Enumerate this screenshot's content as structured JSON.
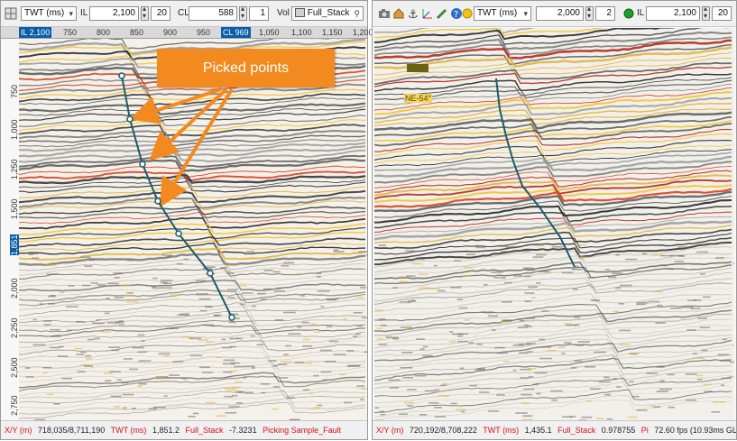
{
  "left": {
    "domain_select": "TWT (ms)",
    "il_label": "IL",
    "il_value": "2,100",
    "il_step": "20",
    "cl_label": "CL",
    "cl_value": "588",
    "cl_step": "1",
    "vol_label": "Vol",
    "vol_value": "Full_Stack",
    "ruler_labels": [
      "IL 2,100",
      "750",
      "800",
      "850",
      "900",
      "950",
      "CL 969",
      "1,050",
      "1,100",
      "1,150",
      "1,200"
    ],
    "y_labels": [
      "750",
      "1,000",
      "1,250",
      "1,500",
      "1,851",
      "2,000",
      "2,250",
      "2,500",
      "2,750"
    ],
    "callout": "Picked points",
    "status": {
      "xy_label": "X/Y (m)",
      "xy_value": "718,035/8,711,190",
      "twt_label": "TWT (ms)",
      "twt_value": "1,851.2",
      "vol_label": "Full_Stack",
      "vol_value": "-7.3231",
      "pick_label": "Picking Sample_Fault"
    }
  },
  "right": {
    "domain_select": "TWT (ms)",
    "value_1": "2,000",
    "step_1": "2",
    "il_label": "IL",
    "il_value": "2,100",
    "il_step": "20",
    "annotation": "NE-54°",
    "status": {
      "xy_label": "X/Y (m)",
      "xy_value": "720,192/8,708,222",
      "twt_label": "TWT (ms)",
      "twt_value": "1,435.1",
      "vol_label": "Full_Stack",
      "vol_value": "0.978755",
      "pi_label": "Pi",
      "fps_text": "72.60 fps (10.93ms GL, 13.77ms total)"
    }
  },
  "colors": {
    "fault": "#1a5c6b",
    "callout": "#f28a1f",
    "status_red": "#d0121b",
    "ruler_marker": "#0a5ea8"
  }
}
